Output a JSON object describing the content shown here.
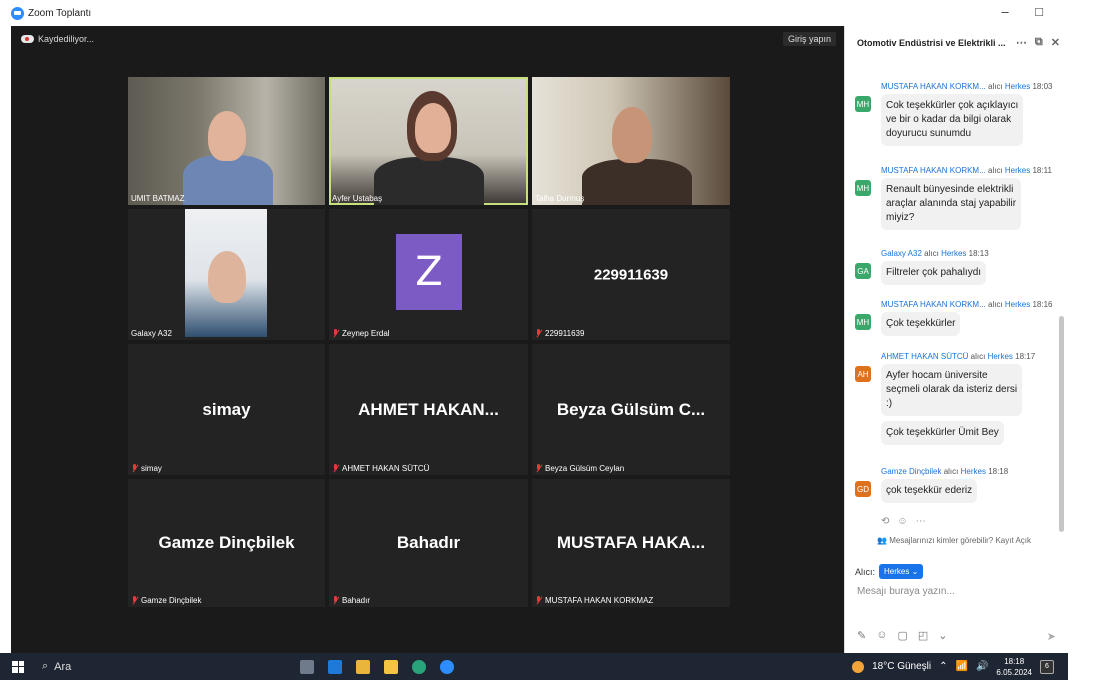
{
  "window": {
    "title": "Zoom Toplantı",
    "controls": [
      "–",
      "□",
      "✕"
    ]
  },
  "meeting": {
    "recording": "Kaydediliyor...",
    "signin": "Giriş yapın",
    "tiles": [
      {
        "name": "UMIT BATMAZ",
        "type": "video"
      },
      {
        "name": "Ayfer Ustabaş",
        "type": "video",
        "active": true
      },
      {
        "name": "Talha Durmuş",
        "type": "video"
      },
      {
        "name": "Galaxy A32",
        "type": "video"
      },
      {
        "name": "Zeynep Erdal",
        "display": "Z",
        "type": "avatar",
        "muted": true
      },
      {
        "name": "229911639",
        "display": "229911639",
        "type": "name",
        "muted": true
      },
      {
        "name": "simay",
        "display": "simay",
        "type": "name",
        "muted": true
      },
      {
        "name": "AHMET HAKAN SÜTCÜ",
        "display": "AHMET  HAKAN...",
        "type": "name",
        "muted": true
      },
      {
        "name": "Beyza Gülsüm Ceylan",
        "display": "Beyza Gülsüm C...",
        "type": "name",
        "muted": true
      },
      {
        "name": "Gamze Dinçbilek",
        "display": "Gamze Dinçbilek",
        "type": "name",
        "muted": true
      },
      {
        "name": "Bahadır",
        "display": "Bahadır",
        "type": "name",
        "muted": true
      },
      {
        "name": "MUSTAFA HAKAN KORKMAZ",
        "display": "MUSTAFA  HAKA...",
        "type": "name",
        "muted": true
      }
    ]
  },
  "chat": {
    "title": "Otomotiv Endüstrisi ve Elektrikli ...",
    "messages": [
      {
        "sender": "MUSTAFA HAKAN KORKM...",
        "to": "alıcı",
        "audience": "Herkes",
        "time": "18:03",
        "initials": "MH",
        "color": "#3aa86b",
        "lines": [
          "Cok teşekkürler çok açıklayıcı",
          "ve bir o kadar da bilgi olarak",
          "doyurucu sunumdu"
        ]
      },
      {
        "sender": "MUSTAFA HAKAN KORKM...",
        "to": "alıcı",
        "audience": "Herkes",
        "time": "18:11",
        "initials": "MH",
        "color": "#3aa86b",
        "lines": [
          "Renault bünyesinde elektrikli",
          "araçlar alanında staj yapabilir",
          "miyiz?"
        ]
      },
      {
        "sender": "Galaxy A32",
        "to": "alıcı",
        "audience": "Herkes",
        "time": "18:13",
        "initials": "GA",
        "color": "#3aa86b",
        "lines": [
          "Filtreler çok pahalıydı"
        ]
      },
      {
        "sender": "MUSTAFA HAKAN KORKM...",
        "to": "alıcı",
        "audience": "Herkes",
        "time": "18:16",
        "initials": "MH",
        "color": "#3aa86b",
        "lines": [
          "Çok teşekkürler"
        ]
      },
      {
        "sender": "AHMET HAKAN SÜTCÜ",
        "to": "alıcı",
        "audience": "Herkes",
        "time": "18:17",
        "initials": "AH",
        "color": "#e0711c",
        "lines": [
          "Ayfer hocam üniversite",
          "seçmeli olarak da isteriz dersi",
          ":)"
        ],
        "extra": "Çok teşekkürler Ümit Bey"
      },
      {
        "sender": "Gamze Dinçbilek",
        "to": "alıcı",
        "audience": "Herkes",
        "time": "18:18",
        "initials": "GD",
        "color": "#e0711c",
        "lines": [
          "çok teşekkür ederiz"
        ]
      }
    ],
    "visibility": "Mesajlarınızı kimler görebilir? Kayıt Açık",
    "recipient_label": "Alıcı:",
    "recipient_value": "Herkes ⌄",
    "input_placeholder": "Mesajı buraya yazın..."
  },
  "taskbar": {
    "search": "Ara",
    "weather": "18°C Güneşli",
    "time": "18:18",
    "date": "6.05.2024",
    "notifications": "6"
  }
}
